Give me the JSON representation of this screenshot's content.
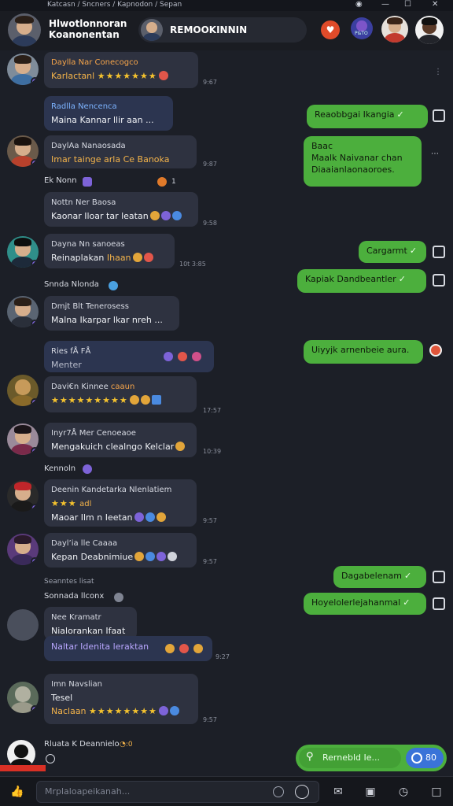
{
  "window": {
    "breadcrumb": "Katcasn / Sncners / Kapnodon / Sepan",
    "controls": [
      "◉",
      "—",
      "☐",
      "✕"
    ]
  },
  "header": {
    "title_line1": "Hlwotlonnoran",
    "title_line2": "Koanonentan",
    "chat_name": "REMOOKINNIN",
    "avatar_badge": "P&TO"
  },
  "messages": [
    {
      "name": "Daylla Nar Conecogco",
      "line": "Karlactanl",
      "stars": "★★★★★★★",
      "time": "9:67"
    },
    {
      "name": "Radlla Nencenca",
      "line": "Maina Kannar llir aan ...",
      "time": ""
    },
    {
      "name": "DaylАa Nanaosada",
      "line": "Imar tainge arla Ce Banoka",
      "time": "9:87"
    },
    {
      "name": "Nottn Ner Baosa",
      "line": "Kaonar Iloar tar leatan",
      "time": "9:58"
    },
    {
      "name": "Dayna Nn sanoeas",
      "line": "Reinaplakan",
      "highlight": "Ihaan",
      "time": "10t 3:85"
    },
    {
      "name": "Dmjt Blt Tenerosess",
      "line": "Malna Ikarpar lkar nreh ...",
      "time": ""
    },
    {
      "name": "Ries fÅ FÅ",
      "line": "Menter",
      "time": ""
    },
    {
      "name": "Davi€n Kinnee",
      "name_accent": "caaun",
      "stars": "★★★★★★★★★",
      "time": "17:57"
    },
    {
      "name": "Inyr7Å Mer Cenoeaoe",
      "line": "Mengakuich clealngo Kelclar",
      "time": "10:39"
    },
    {
      "name": "Deenin Kandetarka Nlenlatiem",
      "stars": "★★★",
      "stars_label": "adl",
      "line": "Maoar Ilm n Ieetan",
      "time": "9:57"
    },
    {
      "name": "Dayl’ia lle Caaaa",
      "line": "Kepan Deabnimiue",
      "time": "9:57"
    },
    {
      "name": "Nee Kramatr",
      "line": "Nialorankan Ifaat",
      "time": ""
    },
    {
      "line": "Naltar Idenita leraktan",
      "time": "9:27"
    },
    {
      "name": "Imn Navslian",
      "line": "Tesel",
      "stars_label": "Naclaan",
      "stars": "★★★★★★★★",
      "time": "9:57"
    }
  ],
  "system_names": [
    {
      "text": "Ek Nonn",
      "extra": "1"
    },
    {
      "text": "Snnda Nlonda"
    },
    {
      "text": "Kennoln"
    },
    {
      "text": "Seanntes lisat"
    },
    {
      "text": "Sonnada llconx"
    },
    {
      "text": "Rluata K Deannielo",
      "extra": "◔:0"
    }
  ],
  "outgoing": [
    {
      "text": "Reaobbgai Ikangia",
      "check": "✓"
    },
    {
      "text": "Baac\nMaalk Naivanar chan\nDiaaianlaonaoroes.",
      "check": ""
    },
    {
      "text": "Cargarmt",
      "check": "✓"
    },
    {
      "text": "Kapiak Dandbeantler",
      "check": "✓"
    },
    {
      "text": "Uiyyjk arnenbeie aura.",
      "check": ""
    },
    {
      "text": "Dagabelenam",
      "check": "✓"
    },
    {
      "text": "Hoyelolerlejahanmal",
      "check": "✓"
    }
  ],
  "search": {
    "label": "Rernebld Ie...",
    "wa_label": "80"
  },
  "composer": {
    "placeholder": "Mrplaloapeikanah..."
  },
  "colors": {
    "accent_green": "#4caf3d",
    "bubble": "#2e3240",
    "background": "#1c1f27",
    "star": "#f4c22e"
  },
  "icons": [
    "like-icon",
    "emoji-icon",
    "timer-icon",
    "mail-icon",
    "save-icon",
    "clock-icon",
    "chat-icon",
    "search-icon",
    "whatsapp-icon",
    "more-icon",
    "heart-icon"
  ]
}
